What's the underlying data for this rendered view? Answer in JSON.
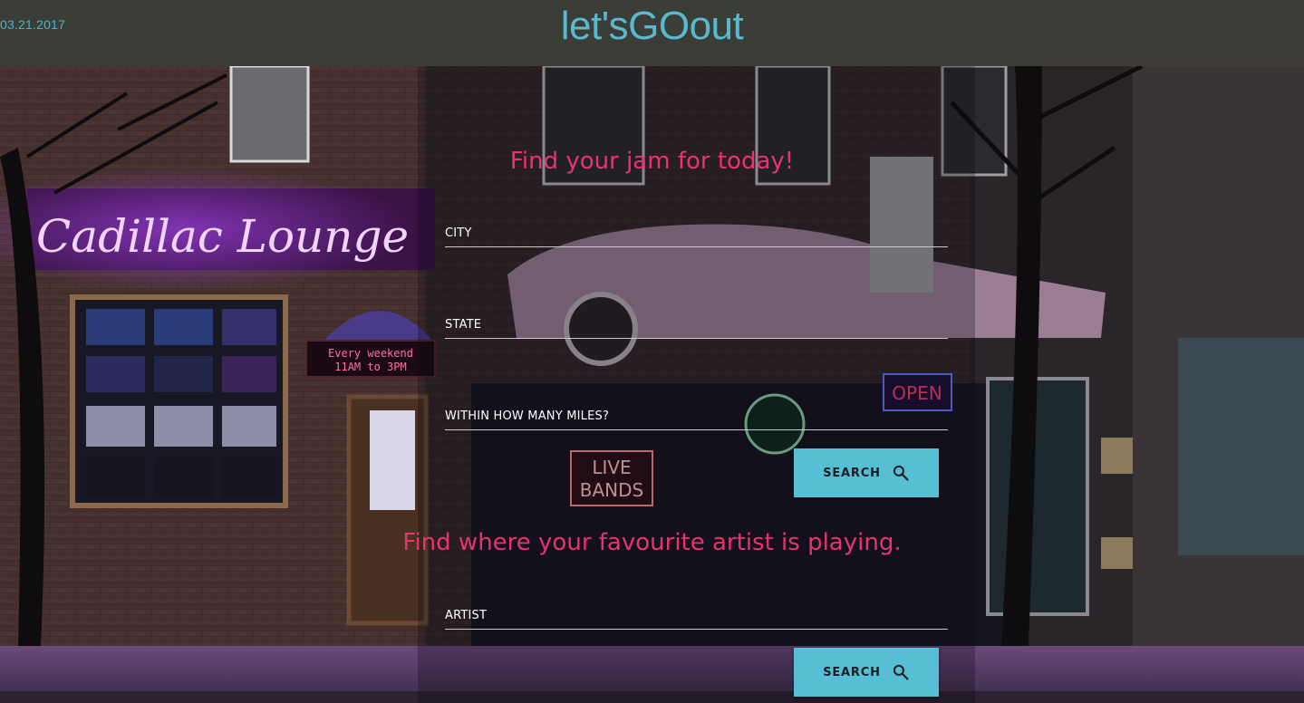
{
  "header": {
    "date": "03.21.2017",
    "brand": "let'sGOout"
  },
  "scene": {
    "neon_sign": "Cadillac Lounge",
    "scroll_sign_line1": "Every weekend",
    "scroll_sign_line2": "11AM to 3PM",
    "live_bands_line1": "LIVE",
    "live_bands_line2": "BANDS",
    "open_sign": "OPEN"
  },
  "location_search": {
    "heading": "Find your jam for today!",
    "city_placeholder": "CITY",
    "state_placeholder": "STATE",
    "miles_placeholder": "WITHIN HOW MANY MILES?",
    "button_label": "SEARCH"
  },
  "artist_search": {
    "heading": "Find where your favourite artist is playing.",
    "artist_placeholder": "ARTIST",
    "button_label": "SEARCH"
  },
  "colors": {
    "header_bg": "#3b3d37",
    "brand": "#5ab9cf",
    "heading": "#e8336f",
    "button": "#56bfd3"
  },
  "icons": {
    "search_button_icon": "search-icon"
  }
}
